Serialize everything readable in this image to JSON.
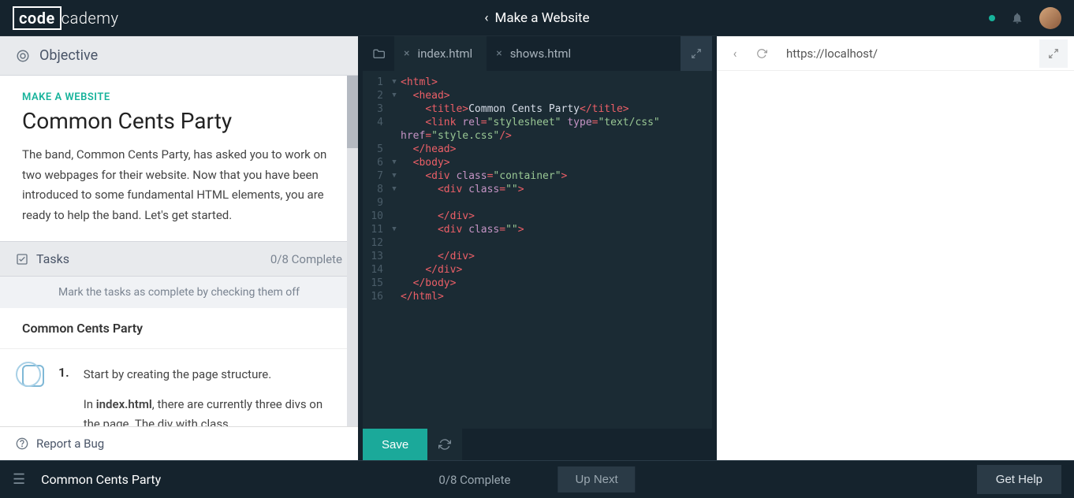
{
  "logo": {
    "boxed": "code",
    "rest": "cademy"
  },
  "header": {
    "lesson_title": "Make a Website"
  },
  "left": {
    "objective_label": "Objective",
    "course_name": "MAKE A WEBSITE",
    "page_title": "Common Cents Party",
    "description": "The band, Common Cents Party, has asked you to work on two webpages for their website. Now that you have been introduced to some fundamental HTML elements, you are ready to help the band. Let's get started.",
    "tasks_label": "Tasks",
    "tasks_progress": "0/8 Complete",
    "tasks_hint": "Mark the tasks as complete by checking them off",
    "section_title": "Common Cents Party",
    "task1": {
      "num": "1.",
      "line1": "Start by creating the page structure.",
      "line2_prefix": "In ",
      "line2_bold": "index.html",
      "line2_suffix": ", there are currently three divs on the page. The div with class"
    },
    "report_bug": "Report a Bug"
  },
  "editor": {
    "tabs": [
      {
        "label": "index.html",
        "active": true
      },
      {
        "label": "shows.html",
        "active": false
      }
    ],
    "save_label": "Save",
    "code": {
      "line1": "<html>",
      "line2_tag": "<head>",
      "line3_open": "<title>",
      "line3_text": "Common Cents Party",
      "line3_close": "</title>",
      "line4_a": "<link",
      "line4_b": "rel",
      "line4_c": "\"stylesheet\"",
      "line4_d": "type",
      "line4_e": "\"text/css\"",
      "line4b_a": "href",
      "line4b_b": "\"style.css\"",
      "line4b_c": "/>",
      "line5": "</head>",
      "line6": "<body>",
      "line7_a": "<div",
      "line7_b": "class",
      "line7_c": "\"container\"",
      "line7_d": ">",
      "line8_a": "<div",
      "line8_b": "class",
      "line8_c": "\"\"",
      "line8_d": ">",
      "line10": "</div>",
      "line11_a": "<div",
      "line11_b": "class",
      "line11_c": "\"\"",
      "line11_d": ">",
      "line13": "</div>",
      "line14": "</div>",
      "line15": "</body>",
      "line16": "</html>"
    }
  },
  "browser": {
    "url": "https://localhost/"
  },
  "footer": {
    "title": "Common Cents Party",
    "progress": "0/8 Complete",
    "upnext": "Up Next",
    "gethelp": "Get Help"
  }
}
